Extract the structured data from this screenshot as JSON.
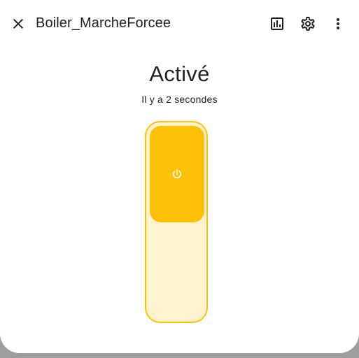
{
  "header": {
    "title": "Boiler_MarcheForcee"
  },
  "entity": {
    "state": "Activé",
    "last_changed": "Il y a 2 secondes",
    "is_on": true
  },
  "colors": {
    "accent": "#ffc107",
    "track_bg": "#fff3cf",
    "text": "#212121"
  },
  "icons": {
    "close": "close-icon",
    "history": "chart-box-icon",
    "settings": "gear-icon",
    "more": "dots-vertical-icon",
    "power": "power-icon"
  }
}
